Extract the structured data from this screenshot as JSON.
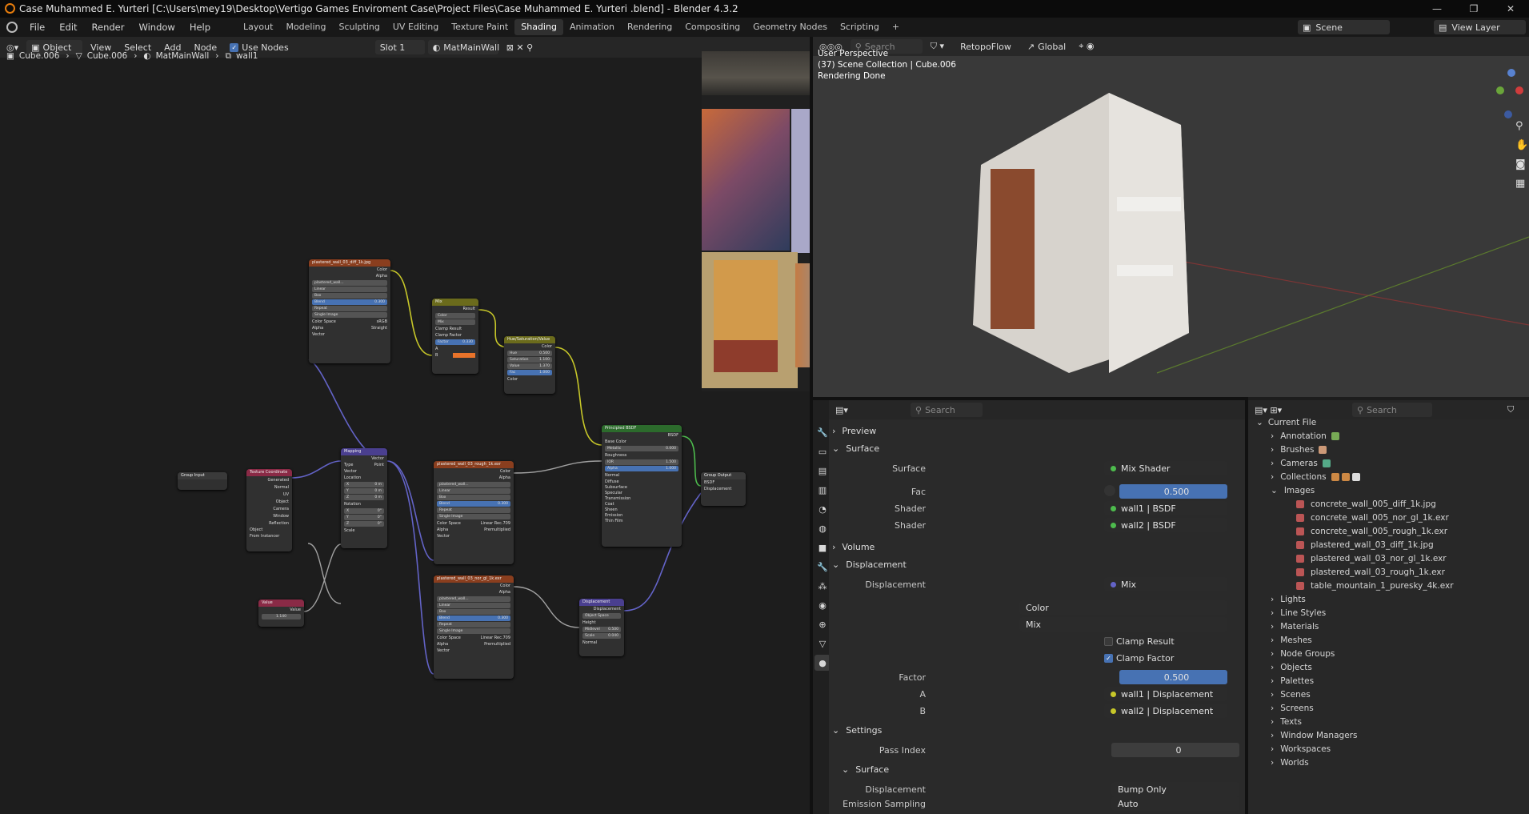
{
  "window": {
    "title": "Case Muhammed E. Yurteri  [C:\\Users\\mey19\\Desktop\\Vertigo Games Enviroment Case\\Project Files\\Case Muhammed E. Yurteri .blend] - Blender 4.3.2",
    "controls": [
      "—",
      "❐",
      "✕"
    ]
  },
  "menu": [
    "File",
    "Edit",
    "Render",
    "Window",
    "Help"
  ],
  "workspaces": [
    "Layout",
    "Modeling",
    "Sculpting",
    "UV Editing",
    "Texture Paint",
    "Shading",
    "Animation",
    "Rendering",
    "Compositing",
    "Geometry Nodes",
    "Scripting"
  ],
  "active_workspace": "Shading",
  "scene_name": "Scene",
  "view_layer": "View Layer",
  "node_editor": {
    "mode": "Object",
    "menus": [
      "View",
      "Select",
      "Add",
      "Node"
    ],
    "use_nodes_label": "Use Nodes",
    "slot": "Slot 1",
    "material": "MatMainWall",
    "breadcrumb": [
      "Cube.006",
      "Cube.006",
      "MatMainWall",
      "wall1"
    ]
  },
  "nodes": {
    "diff_texture": {
      "title": "plastered_wall_03_diff_1k.jpg",
      "out1": "Color",
      "out2": "Alpha",
      "file": "plastered_wall...",
      "interp": "Linear",
      "proj": "Box",
      "blend_label": "Blend",
      "blend": "0.300",
      "ext": "Repeat",
      "src": "Single Image",
      "cs_label": "Color Space",
      "cs": "sRGB",
      "alpha_label": "Alpha",
      "alpha": "Straight",
      "vec": "Vector"
    },
    "mix": {
      "title": "Mix",
      "out": "Result",
      "type": "Color",
      "mode": "Mix",
      "clamp_result": "Clamp Result",
      "clamp_factor": "Clamp Factor",
      "factor_label": "Factor",
      "factor": "0.330",
      "a": "A",
      "b": "B"
    },
    "hsv": {
      "title": "Hue/Saturation/Value",
      "out": "Color",
      "hue_label": "Hue",
      "hue": "0.500",
      "sat_label": "Saturation",
      "sat": "1.100",
      "val_label": "Value",
      "val": "1.370",
      "fac_label": "Fac",
      "fac": "1.000",
      "in": "Color"
    },
    "principled": {
      "title": "Principled BSDF",
      "out": "BSDF",
      "base": "Base Color",
      "metallic_label": "Metallic",
      "metallic": "0.000",
      "rough": "Roughness",
      "ior_label": "IOR",
      "ior": "1.500",
      "alpha_label": "Alpha",
      "alpha": "1.000",
      "normal": "Normal",
      "panels": [
        "Diffuse",
        "Subsurface",
        "Specular",
        "Transmission",
        "Coat",
        "Sheen",
        "Emission",
        "Thin Film"
      ]
    },
    "group_output": {
      "title": "Group Output",
      "bsdf": "BSDF",
      "disp": "Displacement"
    },
    "group_input": {
      "title": "Group Input"
    },
    "texcoord": {
      "title": "Texture Coordinate",
      "outs": [
        "Generated",
        "Normal",
        "UV",
        "Object",
        "Camera",
        "Window",
        "Reflection"
      ],
      "object_label": "Object",
      "from_instancer": "From Instancer"
    },
    "mapping": {
      "title": "Mapping",
      "out": "Vector",
      "type_label": "Type",
      "type": "Point",
      "vec": "Vector",
      "loc": "Location",
      "rot": "Rotation",
      "scale": "Scale",
      "x": "X",
      "y": "Y",
      "z": "Z",
      "m": "0 m",
      "deg": "0°"
    },
    "value": {
      "title": "Value",
      "out": "Value",
      "val": "1.140"
    },
    "rough_texture": {
      "title": "plastered_wall_03_rough_1k.exr",
      "file": "plastered_wall...",
      "cs": "Linear Rec.709",
      "alpha": "Premultiplied",
      "blend": "0.300"
    },
    "nor_texture": {
      "title": "plastered_wall_03_nor_gl_1k.exr",
      "file": "plastered_wall...",
      "cs": "Linear Rec.709",
      "alpha": "Premultiplied",
      "blend": "0.300"
    },
    "displacement": {
      "title": "Displacement",
      "out": "Displacement",
      "space": "Object Space",
      "height": "Height",
      "mid_label": "Midlevel",
      "mid": "0.500",
      "scale_label": "Scale",
      "scale": "0.040",
      "normal": "Normal"
    }
  },
  "viewport": {
    "line1": "User Perspective",
    "line2": "(37) Scene Collection | Cube.006",
    "line3": "Rendering Done",
    "transform": "Global",
    "addon": "RetopoFlow",
    "search": "Search"
  },
  "properties": {
    "search": "Search",
    "preview": "Preview",
    "surface_section": "Surface",
    "surface_label": "Surface",
    "surface": "Mix Shader",
    "fac_label": "Fac",
    "fac": "0.500",
    "shader_label": "Shader",
    "shader1": "wall1 | BSDF",
    "shader2": "wall2 | BSDF",
    "volume": "Volume",
    "displacement_section": "Displacement",
    "displacement_label": "Displacement",
    "displacement": "Mix",
    "color": "Color",
    "mix": "Mix",
    "clamp_result": "Clamp Result",
    "clamp_factor": "Clamp Factor",
    "factor_label": "Factor",
    "factor": "0.500",
    "a_label": "A",
    "a": "wall1 | Displacement",
    "b_label": "B",
    "b": "wall2 | Displacement",
    "settings": "Settings",
    "pass_index_label": "Pass Index",
    "pass_index": "0",
    "surface_sub": "Surface",
    "disp_method_label": "Displacement",
    "disp_method": "Bump Only",
    "emission_label": "Emission Sampling",
    "emission": "Auto"
  },
  "outliner": {
    "search": "Search",
    "root": "Current File",
    "items": [
      {
        "label": "Annotation",
        "color": "#9b6"
      },
      {
        "label": "Brushes",
        "color": "#c97"
      },
      {
        "label": "Cameras",
        "color": "#6a8"
      },
      {
        "label": "Collections",
        "color": "#ddd"
      },
      {
        "label": "Images",
        "color": "#c66"
      }
    ],
    "images": [
      "concrete_wall_005_diff_1k.jpg",
      "concrete_wall_005_nor_gl_1k.exr",
      "concrete_wall_005_rough_1k.exr",
      "plastered_wall_03_diff_1k.jpg",
      "plastered_wall_03_nor_gl_1k.exr",
      "plastered_wall_03_rough_1k.exr",
      "table_mountain_1_puresky_4k.exr"
    ],
    "items2": [
      "Lights",
      "Line Styles",
      "Materials",
      "Meshes",
      "Node Groups",
      "Objects",
      "Palettes",
      "Scenes",
      "Screens",
      "Texts",
      "Window Managers",
      "Workspaces",
      "Worlds"
    ]
  },
  "colors": {
    "accent": "#4772b3",
    "texture_header": "#8a3e1e",
    "mix_header": "#6b6b1c",
    "bsdf_header": "#2c6b2c",
    "vector_header": "#4a3f8f",
    "input_header": "#8a2a46",
    "output_header": "#3a3a3a"
  }
}
